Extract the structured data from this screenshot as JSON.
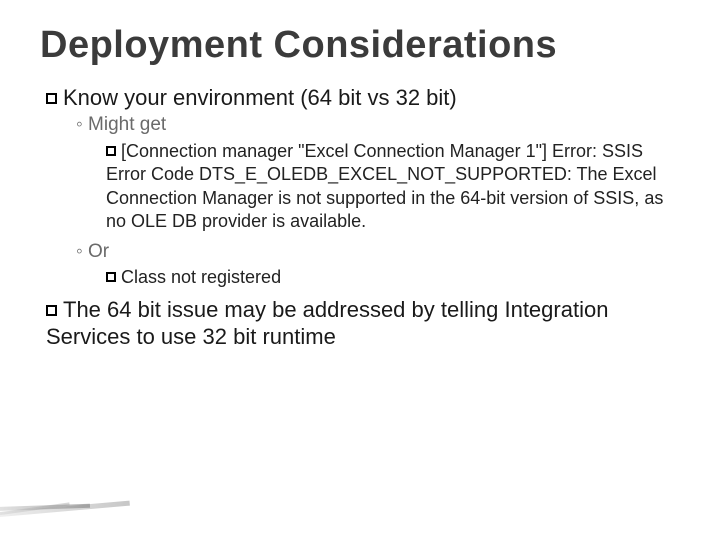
{
  "title": "Deployment Considerations",
  "bullets": {
    "b1": "Know your environment (64 bit vs 32 bit)",
    "b1_1": "Might get",
    "b1_1_1": "[Connection manager \"Excel Connection Manager 1\"] Error: SSIS Error Code DTS_E_OLEDB_EXCEL_NOT_SUPPORTED: The Excel Connection Manager is not supported in the 64-bit version of SSIS, as no OLE DB provider is available.",
    "b1_2": "Or",
    "b1_2_1": "Class not registered",
    "b2": "The 64 bit issue may be addressed by telling Integration Services to use 32 bit runtime"
  }
}
